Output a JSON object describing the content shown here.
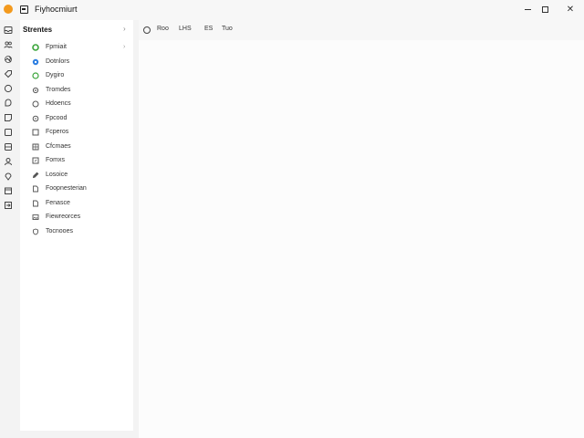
{
  "window": {
    "title": "Fiyhocmiurt",
    "accent": "#f39a1e"
  },
  "sidebar": {
    "title": "Strentes",
    "items": [
      {
        "label": "Fpmiait",
        "icon": "green-circle-icon",
        "color": "#3aa53a",
        "has_chevron": true
      },
      {
        "label": "Dotnlors",
        "icon": "blue-circle-icon",
        "color": "#2a7de1",
        "has_chevron": false
      },
      {
        "label": "Dygiro",
        "icon": "green-ring-icon",
        "color": "#3aa53a",
        "has_chevron": false
      },
      {
        "label": "Tromdes",
        "icon": "gear-icon",
        "color": "#555555",
        "has_chevron": false
      },
      {
        "label": "Hdoencs",
        "icon": "circle-outline-icon",
        "color": "#555555",
        "has_chevron": false
      },
      {
        "label": "Fpcood",
        "icon": "gear-icon",
        "color": "#555555",
        "has_chevron": false
      },
      {
        "label": "Fcperos",
        "icon": "square-outline-icon",
        "color": "#555555",
        "has_chevron": false
      },
      {
        "label": "Cfcmaes",
        "icon": "grid-icon",
        "color": "#555555",
        "has_chevron": false
      },
      {
        "label": "Fomxs",
        "icon": "edit-icon",
        "color": "#555555",
        "has_chevron": false
      },
      {
        "label": "Losoice",
        "icon": "pen-icon",
        "color": "#555555",
        "has_chevron": false
      },
      {
        "label": "Foopnesterian",
        "icon": "document-icon",
        "color": "#555555",
        "has_chevron": false
      },
      {
        "label": "Fenasce",
        "icon": "document-icon",
        "color": "#555555",
        "has_chevron": false
      },
      {
        "label": "Fiewreorces",
        "icon": "image-icon",
        "color": "#555555",
        "has_chevron": false
      },
      {
        "label": "Tocnooes",
        "icon": "shield-icon",
        "color": "#555555",
        "has_chevron": false
      }
    ]
  },
  "rail": {
    "icons": [
      "inbox-icon",
      "users-icon",
      "link-icon",
      "tag-icon",
      "circle-icon",
      "chat-icon",
      "note-icon",
      "square-icon",
      "card-icon",
      "person-icon",
      "location-icon",
      "calendar-icon",
      "sign-in-icon"
    ]
  },
  "toolbar": {
    "items": [
      "Roo",
      "LHS",
      "ES",
      "Tuo"
    ]
  }
}
